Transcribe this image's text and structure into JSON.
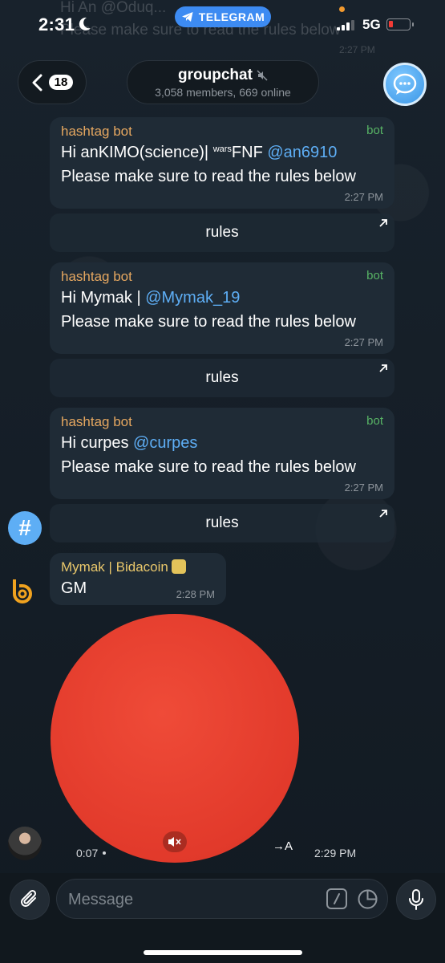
{
  "status_bar": {
    "time": "2:31",
    "pill_label": "TELEGRAM",
    "network": "5G",
    "ghost_line1": "Hi An @Oduq...",
    "ghost_line2": "Please make sure to read the rules below",
    "ghost_time": "2:27 PM"
  },
  "header": {
    "unread_count": "18",
    "title": "groupchat",
    "subtitle": "3,058 members, 669 online"
  },
  "messages": [
    {
      "sender": "hashtag bot",
      "bot_label": "bot",
      "greeting": "Hi anKIMO(science)| ",
      "greeting_sup": "wars",
      "greeting_tail": "FNF ",
      "mention": "@an6910",
      "line2": "Please make sure to read the rules below",
      "time": "2:27 PM",
      "button": "rules"
    },
    {
      "sender": "hashtag bot",
      "bot_label": "bot",
      "greeting": "Hi Mymak | ",
      "mention": "@Mymak_19",
      "line2": "Please make sure to read the rules below",
      "time": "2:27 PM",
      "button": "rules"
    },
    {
      "sender": "hashtag bot",
      "bot_label": "bot",
      "greeting": "Hi curpes ",
      "mention": "@curpes",
      "line2": "Please make sure to read the rules below",
      "time": "2:27 PM",
      "button": "rules"
    }
  ],
  "hash_avatar": "#",
  "gm_message": {
    "sender": "Mymak | Bidacoin",
    "text": "GM",
    "time": "2:28 PM"
  },
  "video_message": {
    "duration": "0:07",
    "translate": "→A",
    "time": "2:29 PM"
  },
  "input": {
    "placeholder": "Message"
  },
  "colors": {
    "accent": "#5eaef5",
    "bot_name": "#e5a760",
    "bot_label": "#58b465",
    "video": "#e23a2b"
  }
}
